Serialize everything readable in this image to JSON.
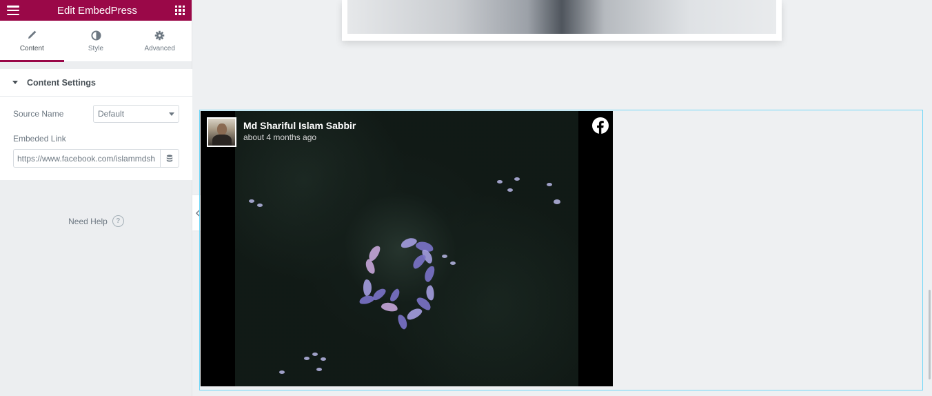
{
  "header": {
    "title": "Edit EmbedPress",
    "menu_icon": "hamburger-icon",
    "apps_icon": "grid-icon"
  },
  "tabs": [
    {
      "label": "Content",
      "icon": "pencil-icon",
      "active": true
    },
    {
      "label": "Style",
      "icon": "half-circle-icon",
      "active": false
    },
    {
      "label": "Advanced",
      "icon": "gear-icon",
      "active": false
    }
  ],
  "section": {
    "title": "Content Settings",
    "source": {
      "label": "Source Name",
      "value": "Default"
    },
    "link": {
      "label": "Embeded Link",
      "value": "https://www.facebook.com/islammdsh"
    }
  },
  "help": {
    "label": "Need Help",
    "glyph": "?"
  },
  "embed": {
    "author": "Md Shariful Islam Sabbir",
    "time": "about 4 months ago",
    "platform_icon": "facebook-icon"
  },
  "colors": {
    "brand": "#9a0848",
    "embed_border": "#71d7f7",
    "facebook": "#ffffff"
  }
}
